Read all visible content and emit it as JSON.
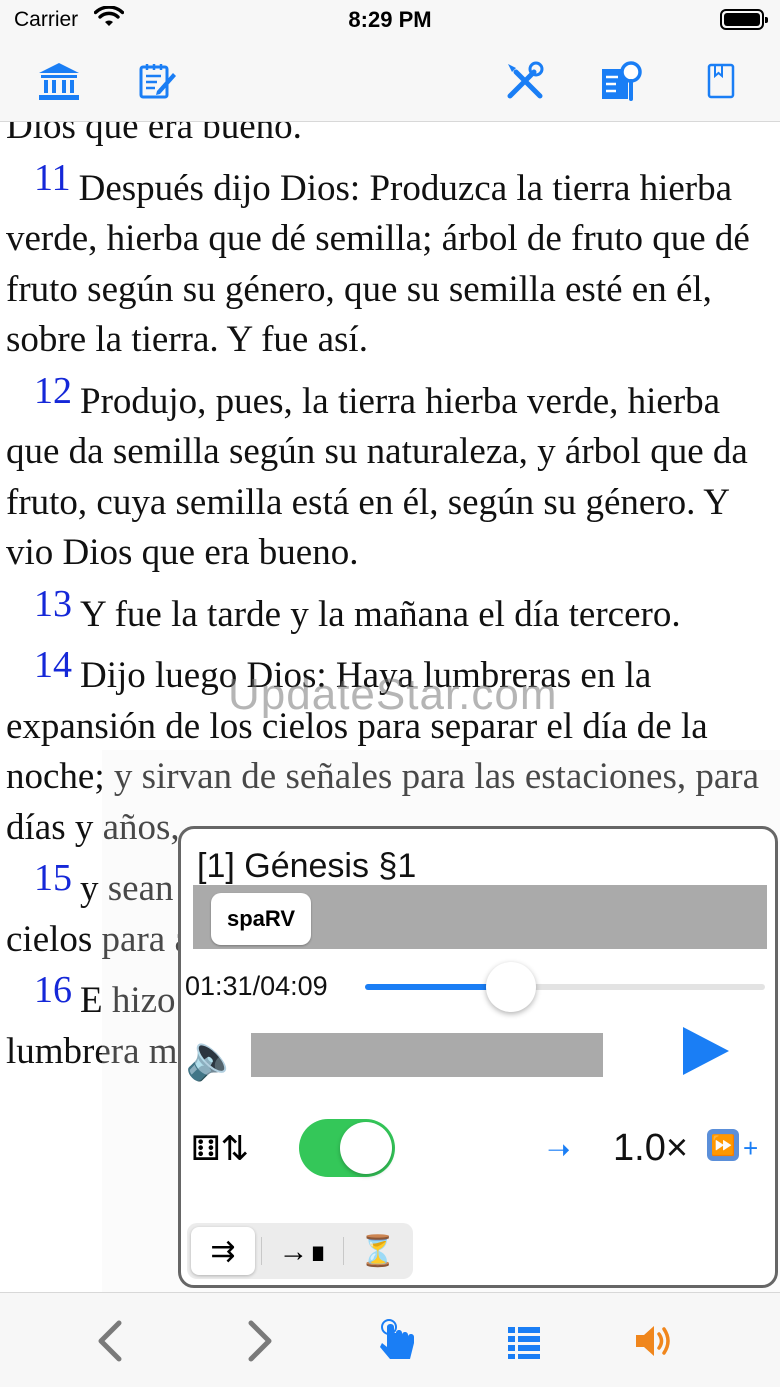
{
  "status": {
    "carrier": "Carrier",
    "time": "8:29 PM"
  },
  "toolbar": {
    "icons": [
      "library-icon",
      "notes-icon",
      "tools-icon",
      "search-icon",
      "bookmark-icon"
    ]
  },
  "verses": [
    {
      "num": "",
      "text": "Dios que era bueno."
    },
    {
      "num": "11",
      "text": "Después dijo Dios: Produzca la tierra hierba verde, hierba que dé semilla; árbol de fruto que dé fruto según su género, que su semilla esté en él, sobre la tierra. Y fue así."
    },
    {
      "num": "12",
      "text": "Produjo, pues, la tierra hierba verde, hierba que da semilla según su naturaleza, y árbol que da fruto, cuya semilla está en él, según su género. Y vio Dios que era bueno."
    },
    {
      "num": "13",
      "text": "Y fue la tarde y la mañana el día tercero."
    },
    {
      "num": "14",
      "text": "Dijo luego Dios: Haya lumbreras en la expansión de los cielos para separar el día de la noche; y sirvan de señales para las estaciones, para días y años,"
    },
    {
      "num": "15",
      "text": "y sean por lumbreras en la expansión de los cielos para alumbrar sobre la tierra. Y fue así."
    },
    {
      "num": "16",
      "text": "E hizo Dios las dos grandes lumbreras; la lumbrera mayor para que señorease en el"
    }
  ],
  "watermark": "UpdateStar.com",
  "player": {
    "title": "[1] Génesis §1",
    "version": "spaRV",
    "time": "01:31/04:09",
    "progress": 0.365,
    "speed": "1.0×",
    "autoscroll_on": true,
    "modes": [
      "⇉",
      "→∎",
      "⏳"
    ],
    "selected_mode": 0
  },
  "bottombar": {
    "icons": [
      "back-chevron-icon",
      "forward-chevron-icon",
      "tap-icon",
      "list-icon",
      "speaker-icon"
    ]
  },
  "colors": {
    "accent": "#1a7ef5",
    "verse_number": "#1528d8",
    "toggle_on": "#34c759",
    "speaker": "#f0861c"
  }
}
